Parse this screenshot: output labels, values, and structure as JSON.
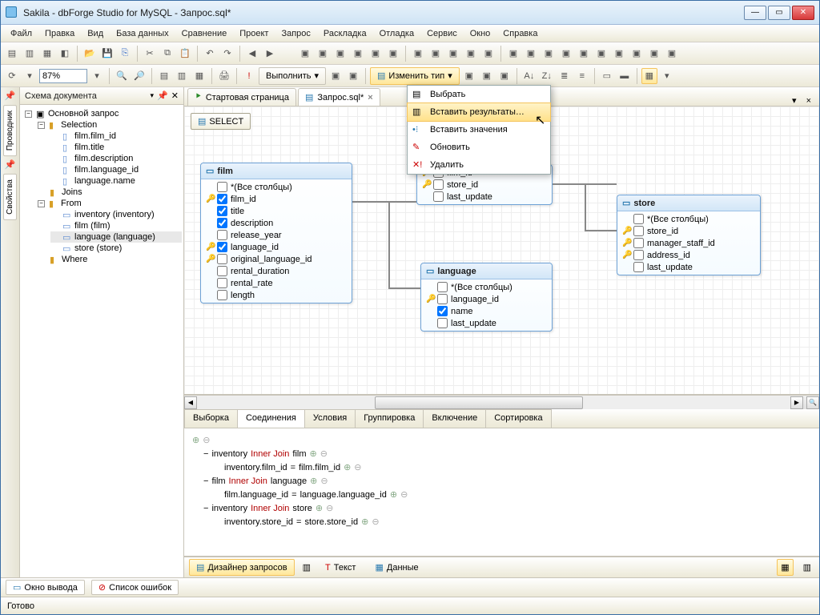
{
  "window": {
    "title": "Sakila - dbForge Studio for MySQL - Запрос.sql*"
  },
  "menubar": [
    "Файл",
    "Правка",
    "Вид",
    "База данных",
    "Сравнение",
    "Проект",
    "Запрос",
    "Раскладка",
    "Отладка",
    "Сервис",
    "Окно",
    "Справка"
  ],
  "toolbar2": {
    "zoom": "87%",
    "execute": "Выполнить",
    "change_type": "Изменить тип"
  },
  "dropdown": {
    "items": [
      "Выбрать",
      "Вставить результаты…",
      "Вставить значения",
      "Обновить",
      "Удалить"
    ],
    "highlight_index": 1
  },
  "side_rail": {
    "tabs": [
      "Проводник",
      "Свойства"
    ]
  },
  "doc_schema": {
    "title": "Схема документа",
    "root": "Основной запрос",
    "selection_label": "Selection",
    "selection": [
      "film.film_id",
      "film.title",
      "film.description",
      "film.language_id",
      "language.name"
    ],
    "joins_label": "Joins",
    "from_label": "From",
    "from": [
      "inventory (inventory)",
      "film (film)",
      "language (language)",
      "store (store)"
    ],
    "where_label": "Where"
  },
  "doc_tabs": [
    {
      "label": "Стартовая страница",
      "active": false
    },
    {
      "label": "Запрос.sql*",
      "active": true
    }
  ],
  "select_chip": "SELECT",
  "tables": {
    "film": {
      "title": "film",
      "cols": [
        {
          "name": "*(Все столбцы)",
          "checked": false,
          "key": false
        },
        {
          "name": "film_id",
          "checked": true,
          "key": true
        },
        {
          "name": "title",
          "checked": true,
          "key": false
        },
        {
          "name": "description",
          "checked": true,
          "key": false
        },
        {
          "name": "release_year",
          "checked": false,
          "key": false
        },
        {
          "name": "language_id",
          "checked": true,
          "key": true
        },
        {
          "name": "original_language_id",
          "checked": false,
          "key": true
        },
        {
          "name": "rental_duration",
          "checked": false,
          "key": false
        },
        {
          "name": "rental_rate",
          "checked": false,
          "key": false
        },
        {
          "name": "length",
          "checked": false,
          "key": false
        }
      ]
    },
    "inventory_cols": [
      {
        "name": "film_id",
        "checked": false,
        "key": true
      },
      {
        "name": "store_id",
        "checked": false,
        "key": true
      },
      {
        "name": "last_update",
        "checked": false,
        "key": false
      }
    ],
    "language": {
      "title": "language",
      "cols": [
        {
          "name": "*(Все столбцы)",
          "checked": false,
          "key": false
        },
        {
          "name": "language_id",
          "checked": false,
          "key": true
        },
        {
          "name": "name",
          "checked": true,
          "key": false
        },
        {
          "name": "last_update",
          "checked": false,
          "key": false
        }
      ]
    },
    "store": {
      "title": "store",
      "cols": [
        {
          "name": "*(Все столбцы)",
          "checked": false,
          "key": false
        },
        {
          "name": "store_id",
          "checked": false,
          "key": true
        },
        {
          "name": "manager_staff_id",
          "checked": false,
          "key": true
        },
        {
          "name": "address_id",
          "checked": false,
          "key": true
        },
        {
          "name": "last_update",
          "checked": false,
          "key": false
        }
      ]
    }
  },
  "query_tabs": [
    "Выборка",
    "Соединения",
    "Условия",
    "Группировка",
    "Включение",
    "Сортировка"
  ],
  "query_tabs_active": 1,
  "joins_panel": [
    {
      "left": "inventory",
      "jt": "Inner Join",
      "right": "film",
      "cond_left": "inventory.film_id",
      "cond_right": "film.film_id"
    },
    {
      "left": "film",
      "jt": "Inner Join",
      "right": "language",
      "cond_left": "film.language_id",
      "cond_right": "language.language_id"
    },
    {
      "left": "inventory",
      "jt": "Inner Join",
      "right": "store",
      "cond_left": "inventory.store_id",
      "cond_right": "store.store_id"
    }
  ],
  "bottom_views": {
    "designer": "Дизайнер запросов",
    "text": "Текст",
    "data": "Данные"
  },
  "output_tabs": [
    "Окно вывода",
    "Список ошибок"
  ],
  "status": "Готово"
}
